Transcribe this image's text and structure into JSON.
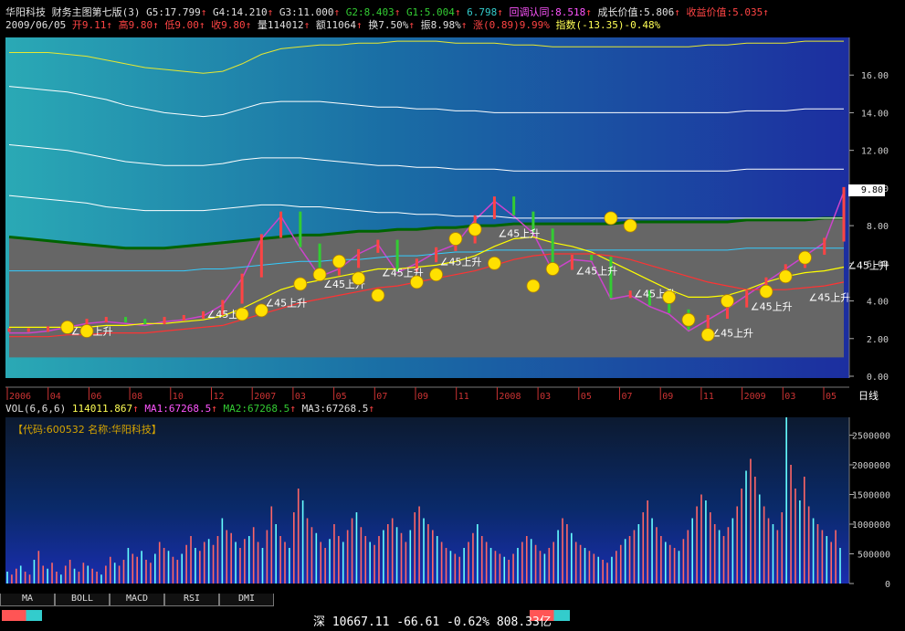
{
  "header": {
    "stock_name": "华阳科技",
    "indicator_title": "财务主图第七版(3)",
    "g5": "G5:17.799",
    "g4": "G4:14.210",
    "g3": "G3:11.000",
    "g2": "G2:8.403",
    "g1": "G1:5.004",
    "g0": "6.798",
    "pullback": "回调认同:8.518",
    "growth": "成长价值:5.806",
    "income": "收益价值:5.035",
    "date": "2009/06/05",
    "open": "开9.11",
    "high": "高9.80",
    "low": "低9.00",
    "close": "收9.80",
    "volume": "量114012",
    "amount": "额11064",
    "turnover": "换7.50%",
    "amplitude": "振8.98%",
    "change": "涨(0.89)9.99%",
    "index": "指数(-13.35)-0.48%"
  },
  "price_tag": "9.80",
  "period_label": "日线",
  "annotation_text": "∠45上升",
  "vol_header": {
    "vol": "VOL(6,6,6)",
    "vol_value": "114011.867",
    "ma1": "MA1:67268.5",
    "ma2": "MA2:67268.5",
    "ma3": "MA3:67268.5"
  },
  "code_label": "【代码:600532 名称:华阳科技】",
  "tabs": [
    "MA",
    "BOLL",
    "MACD",
    "RSI",
    "DMI"
  ],
  "status": "深 10667.11 -66.61 -0.62% 808.33亿",
  "colors": {
    "up": "#ff4444",
    "down": "#33cc33",
    "ma1": "#e0e0e0",
    "ma2": "#ffff00",
    "ma3": "#ff3333",
    "band": "#006400"
  },
  "chart_data": [
    {
      "type": "line",
      "title": "华阳科技 财务主图第七版(3)",
      "ylim": [
        0,
        18
      ],
      "yticks": [
        0.0,
        2.0,
        4.0,
        6.0,
        8.0,
        10.0,
        12.0,
        14.0,
        16.0
      ],
      "ytick_labels": [
        "0.00",
        "2.00",
        "4.00",
        "6.00",
        "8.00",
        "10.00",
        "12.00",
        "14.00",
        "16.00"
      ],
      "x_tick_labels": [
        "2006",
        "04",
        "06",
        "08",
        "10",
        "12",
        "2007",
        "03",
        "05",
        "07",
        "09",
        "11",
        "2008",
        "03",
        "05",
        "07",
        "09",
        "11",
        "2009",
        "03",
        "05"
      ],
      "series": [
        {
          "name": "收",
          "values": [
            2.3,
            2.3,
            2.4,
            2.6,
            2.8,
            2.9,
            2.8,
            2.7,
            2.9,
            3.0,
            3.2,
            3.8,
            5.2,
            7.3,
            8.5,
            6.8,
            5.3,
            5.7,
            6.5,
            7.0,
            5.5,
            6.0,
            6.6,
            7.0,
            8.3,
            9.3,
            8.5,
            7.6,
            5.6,
            6.2,
            6.1,
            4.1,
            4.3,
            3.7,
            3.3,
            2.4,
            3.0,
            3.6,
            4.3,
            5.0,
            5.7,
            6.4,
            7.1,
            9.8
          ]
        },
        {
          "name": "G5",
          "values": [
            17.2,
            17.2,
            17.2,
            17.1,
            17.0,
            16.8,
            16.6,
            16.4,
            16.3,
            16.2,
            16.1,
            16.2,
            16.6,
            17.1,
            17.4,
            17.5,
            17.6,
            17.6,
            17.7,
            17.7,
            17.8,
            17.8,
            17.8,
            17.7,
            17.7,
            17.7,
            17.6,
            17.6,
            17.5,
            17.5,
            17.5,
            17.5,
            17.5,
            17.5,
            17.5,
            17.5,
            17.6,
            17.6,
            17.7,
            17.7,
            17.7,
            17.8,
            17.8,
            17.8
          ]
        },
        {
          "name": "G4",
          "values": [
            15.4,
            15.3,
            15.2,
            15.1,
            14.9,
            14.7,
            14.4,
            14.2,
            14.0,
            13.9,
            13.8,
            13.9,
            14.2,
            14.5,
            14.6,
            14.6,
            14.6,
            14.5,
            14.4,
            14.3,
            14.3,
            14.2,
            14.2,
            14.1,
            14.1,
            14.0,
            14.0,
            14.0,
            14.0,
            14.0,
            14.0,
            14.0,
            14.0,
            14.0,
            14.0,
            14.0,
            14.0,
            14.0,
            14.1,
            14.1,
            14.1,
            14.2,
            14.2,
            14.2
          ]
        },
        {
          "name": "G3",
          "values": [
            12.3,
            12.2,
            12.1,
            12.0,
            11.8,
            11.6,
            11.4,
            11.3,
            11.2,
            11.2,
            11.2,
            11.3,
            11.5,
            11.6,
            11.6,
            11.6,
            11.5,
            11.4,
            11.3,
            11.2,
            11.2,
            11.1,
            11.1,
            11.0,
            11.0,
            11.0,
            10.9,
            10.9,
            10.9,
            10.9,
            10.9,
            10.9,
            10.9,
            10.9,
            10.9,
            10.9,
            10.9,
            10.9,
            11.0,
            11.0,
            11.0,
            11.0,
            11.0,
            11.0
          ]
        },
        {
          "name": "G2",
          "values": [
            9.6,
            9.5,
            9.4,
            9.3,
            9.2,
            9.0,
            8.9,
            8.8,
            8.8,
            8.8,
            8.8,
            8.9,
            9.0,
            9.1,
            9.1,
            9.0,
            9.0,
            8.9,
            8.8,
            8.7,
            8.7,
            8.6,
            8.6,
            8.5,
            8.5,
            8.5,
            8.4,
            8.4,
            8.4,
            8.4,
            8.4,
            8.4,
            8.4,
            8.4,
            8.4,
            8.4,
            8.4,
            8.4,
            8.4,
            8.4,
            8.4,
            8.4,
            8.4,
            8.4
          ]
        },
        {
          "name": "G1",
          "values": [
            7.4,
            7.3,
            7.2,
            7.1,
            7.0,
            6.9,
            6.8,
            6.8,
            6.8,
            6.9,
            7.0,
            7.1,
            7.2,
            7.3,
            7.4,
            7.5,
            7.5,
            7.6,
            7.7,
            7.7,
            7.8,
            7.8,
            7.9,
            7.9,
            8.0,
            8.0,
            8.1,
            8.1,
            8.1,
            8.1,
            8.1,
            8.1,
            8.2,
            8.2,
            8.2,
            8.2,
            8.2,
            8.2,
            8.3,
            8.3,
            8.3,
            8.3,
            8.4,
            8.4
          ]
        },
        {
          "name": "G0",
          "values": [
            5.6,
            5.6,
            5.6,
            5.6,
            5.6,
            5.6,
            5.6,
            5.6,
            5.6,
            5.6,
            5.7,
            5.7,
            5.8,
            5.9,
            6.0,
            6.1,
            6.1,
            6.2,
            6.2,
            6.3,
            6.4,
            6.4,
            6.5,
            6.6,
            6.6,
            6.7,
            6.7,
            6.7,
            6.7,
            6.7,
            6.7,
            6.7,
            6.7,
            6.7,
            6.7,
            6.7,
            6.7,
            6.7,
            6.8,
            6.8,
            6.8,
            6.8,
            6.8,
            6.8
          ]
        },
        {
          "name": "MA2",
          "values": [
            2.6,
            2.6,
            2.6,
            2.6,
            2.6,
            2.7,
            2.7,
            2.8,
            2.8,
            2.9,
            3.0,
            3.2,
            3.6,
            4.1,
            4.6,
            4.9,
            5.1,
            5.3,
            5.5,
            5.7,
            5.7,
            5.8,
            5.9,
            6.1,
            6.4,
            6.9,
            7.3,
            7.4,
            7.1,
            6.9,
            6.6,
            6.1,
            5.6,
            5.1,
            4.6,
            4.2,
            4.2,
            4.3,
            4.6,
            5.0,
            5.3,
            5.5,
            5.6,
            5.8
          ]
        },
        {
          "name": "MA3",
          "values": [
            2.1,
            2.1,
            2.1,
            2.2,
            2.2,
            2.3,
            2.3,
            2.3,
            2.4,
            2.5,
            2.6,
            2.7,
            3.0,
            3.3,
            3.6,
            3.9,
            4.1,
            4.3,
            4.5,
            4.7,
            4.8,
            5.0,
            5.2,
            5.4,
            5.6,
            5.9,
            6.2,
            6.4,
            6.5,
            6.5,
            6.5,
            6.4,
            6.2,
            5.9,
            5.6,
            5.3,
            5.0,
            4.8,
            4.6,
            4.6,
            4.6,
            4.7,
            4.8,
            5.0
          ]
        }
      ]
    },
    {
      "type": "bar",
      "title": "VOL(6,6,6)",
      "ylim": [
        0,
        280000
      ],
      "yticks": [
        0,
        50000,
        100000,
        150000,
        200000,
        250000
      ],
      "ytick_labels": [
        "0",
        "500000",
        "1000000",
        "1500000",
        "2000000",
        "2500000"
      ],
      "values": [
        20000,
        15000,
        25000,
        30000,
        20000,
        15000,
        40000,
        55000,
        30000,
        25000,
        35000,
        20000,
        15000,
        30000,
        40000,
        25000,
        20000,
        35000,
        30000,
        25000,
        20000,
        15000,
        30000,
        45000,
        35000,
        30000,
        40000,
        60000,
        50000,
        45000,
        55000,
        40000,
        35000,
        50000,
        70000,
        60000,
        55000,
        45000,
        40000,
        50000,
        65000,
        80000,
        60000,
        55000,
        70000,
        75000,
        65000,
        80000,
        110000,
        90000,
        85000,
        70000,
        60000,
        75000,
        80000,
        95000,
        70000,
        60000,
        90000,
        130000,
        100000,
        80000,
        70000,
        60000,
        120000,
        160000,
        140000,
        110000,
        95000,
        85000,
        70000,
        60000,
        75000,
        100000,
        80000,
        70000,
        90000,
        110000,
        120000,
        95000,
        80000,
        70000,
        65000,
        80000,
        90000,
        100000,
        110000,
        95000,
        85000,
        70000,
        90000,
        120000,
        130000,
        110000,
        100000,
        90000,
        80000,
        70000,
        60000,
        55000,
        50000,
        45000,
        60000,
        70000,
        85000,
        100000,
        80000,
        70000,
        60000,
        55000,
        50000,
        45000,
        40000,
        50000,
        60000,
        70000,
        80000,
        75000,
        65000,
        55000,
        50000,
        60000,
        70000,
        90000,
        110000,
        100000,
        85000,
        70000,
        65000,
        60000,
        55000,
        50000,
        45000,
        40000,
        35000,
        45000,
        55000,
        65000,
        75000,
        80000,
        90000,
        100000,
        120000,
        140000,
        110000,
        95000,
        80000,
        70000,
        65000,
        60000,
        55000,
        75000,
        90000,
        110000,
        130000,
        150000,
        140000,
        120000,
        100000,
        90000,
        80000,
        95000,
        110000,
        130000,
        160000,
        190000,
        210000,
        180000,
        150000,
        130000,
        110000,
        100000,
        90000,
        120000,
        280000,
        200000,
        160000,
        140000,
        180000,
        130000,
        110000,
        100000,
        90000,
        80000,
        70000,
        90000,
        60000
      ]
    }
  ]
}
